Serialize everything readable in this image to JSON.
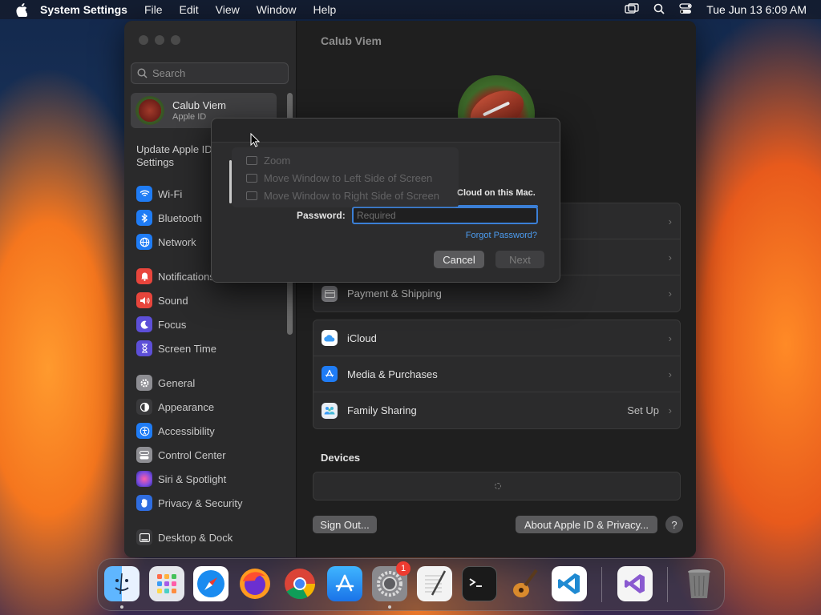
{
  "menubar": {
    "app_name": "System Settings",
    "items": [
      "File",
      "Edit",
      "View",
      "Window",
      "Help"
    ],
    "clock": "Tue Jun 13  6:09 AM"
  },
  "sidebar": {
    "search_placeholder": "Search",
    "account": {
      "name": "Calub Viem",
      "subtitle": "Apple ID"
    },
    "update_text": "Update Apple ID Settings",
    "items": [
      {
        "label": "Wi-Fi",
        "icon": "wifi-icon",
        "color": "#1f7cf5"
      },
      {
        "label": "Bluetooth",
        "icon": "bluetooth-icon",
        "color": "#1f7cf5"
      },
      {
        "label": "Network",
        "icon": "globe-icon",
        "color": "#1f7cf5"
      },
      {
        "label": "Notifications",
        "icon": "bell-icon",
        "color": "#e8453c"
      },
      {
        "label": "Sound",
        "icon": "speaker-icon",
        "color": "#e8453c"
      },
      {
        "label": "Focus",
        "icon": "moon-icon",
        "color": "#5d4fd8"
      },
      {
        "label": "Screen Time",
        "icon": "hourglass-icon",
        "color": "#5d4fd8"
      },
      {
        "label": "General",
        "icon": "gear-icon",
        "color": "#8e8e93"
      },
      {
        "label": "Appearance",
        "icon": "appearance-icon",
        "color": "#3a3a3c"
      },
      {
        "label": "Accessibility",
        "icon": "accessibility-icon",
        "color": "#1f7cf5"
      },
      {
        "label": "Control Center",
        "icon": "control-center-icon",
        "color": "#8e8e93"
      },
      {
        "label": "Siri & Spotlight",
        "icon": "siri-icon",
        "color": "#b544d6"
      },
      {
        "label": "Privacy & Security",
        "icon": "hand-icon",
        "color": "#2f6de0"
      },
      {
        "label": "Desktop & Dock",
        "icon": "dock-icon",
        "color": "#3a3a3c"
      }
    ]
  },
  "main": {
    "title": "Calub Viem",
    "rows_top": [
      {
        "label": "",
        "icon": ""
      },
      {
        "label": "",
        "icon": ""
      },
      {
        "label": "Payment & Shipping",
        "icon": "card-icon",
        "color": "#8e8e93"
      }
    ],
    "rows_services": [
      {
        "label": "iCloud",
        "icon": "icloud-icon",
        "color": "#ffffff",
        "value": ""
      },
      {
        "label": "Media & Purchases",
        "icon": "appstore-icon",
        "color": "#1f7cf5",
        "value": ""
      },
      {
        "label": "Family Sharing",
        "icon": "family-icon",
        "color": "#e9eef5",
        "value": "Set Up"
      }
    ],
    "devices_title": "Devices",
    "sign_out_label": "Sign Out...",
    "about_label": "About Apple ID & Privacy...",
    "help_label": "?"
  },
  "sheet": {
    "message": "Cloud on this Mac.",
    "password_label": "Password:",
    "password_placeholder": "Required",
    "forgot_label": "Forgot Password?",
    "cancel_label": "Cancel",
    "next_label": "Next"
  },
  "window_menu": {
    "items": [
      "Zoom",
      "Move Window to Left Side of Screen",
      "Move Window to Right Side of Screen"
    ]
  },
  "dock": {
    "items": [
      {
        "name": "Finder",
        "icon": "finder-icon"
      },
      {
        "name": "Launchpad",
        "icon": "launchpad-icon"
      },
      {
        "name": "Safari",
        "icon": "safari-icon"
      },
      {
        "name": "Firefox",
        "icon": "firefox-icon"
      },
      {
        "name": "Chrome",
        "icon": "chrome-icon"
      },
      {
        "name": "App Store",
        "icon": "appstore-icon"
      },
      {
        "name": "System Settings",
        "icon": "system-settings-icon"
      },
      {
        "name": "TextEdit",
        "icon": "textedit-icon"
      },
      {
        "name": "Terminal",
        "icon": "terminal-icon"
      },
      {
        "name": "GarageBand",
        "icon": "garageband-icon"
      },
      {
        "name": "VS Code",
        "icon": "vscode-icon"
      },
      {
        "name": "Visual Studio",
        "icon": "visual-studio-icon"
      },
      {
        "name": "Trash",
        "icon": "trash-icon"
      }
    ],
    "settings_badge": "1"
  }
}
